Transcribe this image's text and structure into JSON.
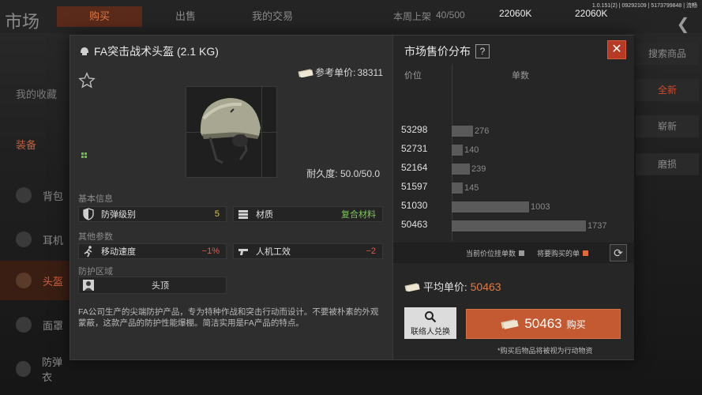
{
  "background": {
    "title": "市场",
    "tabs": [
      "购买",
      "出售",
      "我的交易"
    ],
    "listing_label": "本周上架",
    "listing_count": "40/500",
    "money_1": "22060K",
    "money_2": "22060K",
    "version": "1.0.151(2) | 09292109 | 5173799848 | 流畅",
    "sidebar": [
      "我的收藏",
      "装备"
    ],
    "categories": [
      "背包",
      "耳机",
      "头盔",
      "面罩",
      "防弹衣"
    ],
    "right_buttons": [
      "搜索商品",
      "全新",
      "崭新",
      "磨损"
    ]
  },
  "item": {
    "title": "FA突击战术头盔 (2.1 KG)",
    "ref_price_label": "参考单价:",
    "ref_price": "38311",
    "durability": "耐久度: 50.0/50.0",
    "basic_info_label": "基本信息",
    "other_params_label": "其他参数",
    "protect_area_label": "防护区域",
    "attrs": [
      {
        "name": "防弹级别",
        "value": "5"
      },
      {
        "name": "材质",
        "value": "复合材料"
      },
      {
        "name": "移动速度",
        "value": "−1%"
      },
      {
        "name": "人机工效",
        "value": "−2"
      },
      {
        "name": "头顶",
        "value": ""
      }
    ],
    "description": "FA公司生产的尖端防护产品，专为特种作战和突击行动而设计。不要被朴素的外观蒙蔽，这款产品的防护性能爆棚。简洁实用是FA产品的特点。"
  },
  "market": {
    "title": "市场售价分布",
    "help": "?",
    "close": "✕",
    "col_price": "价位",
    "col_qty": "单数",
    "legend_current": "当前价位挂单数",
    "legend_buy": "将要购买的单",
    "avg_label": "平均单价:",
    "avg_value": "50463",
    "contact_label": "联络人兑换",
    "buy_amount": "50463",
    "buy_label": "购买",
    "note": "*购买后物品将被视为行动物资"
  },
  "chart_data": {
    "type": "bar",
    "orientation": "horizontal",
    "categories": [
      "53298",
      "52731",
      "52164",
      "51597",
      "51030",
      "50463"
    ],
    "values": [
      276,
      140,
      239,
      145,
      1003,
      1737
    ],
    "xlabel": "单数",
    "ylabel": "价位",
    "legend": [
      "当前价位挂单数",
      "将要购买的单"
    ],
    "colors": {
      "bar": "#5a5a5a",
      "current": "#9a9a9a",
      "buy": "#e06a3a"
    }
  }
}
